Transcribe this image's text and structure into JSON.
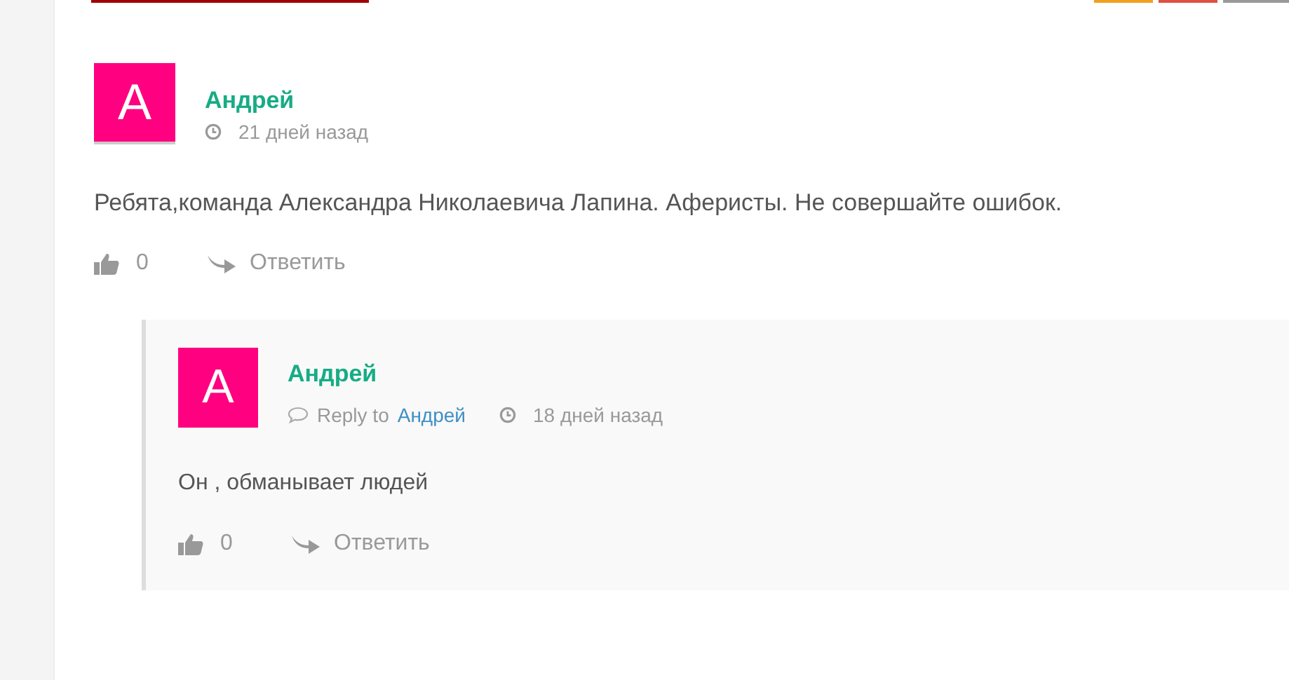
{
  "comments": [
    {
      "author": "Андрей",
      "avatar_letter": "А",
      "time": "21 дней назад",
      "text": "Ребята,команда Александра Николаевича Лапина. Аферисты. Не совершайте ошибок.",
      "likes": "0",
      "reply_label": "Ответить",
      "replies": [
        {
          "author": "Андрей",
          "avatar_letter": "А",
          "reply_to_label": "Reply to",
          "reply_to": "Андрей",
          "time": "18 дней назад",
          "text": "Он , обманывает людей",
          "likes": "0",
          "reply_label": "Ответить"
        }
      ]
    }
  ]
}
